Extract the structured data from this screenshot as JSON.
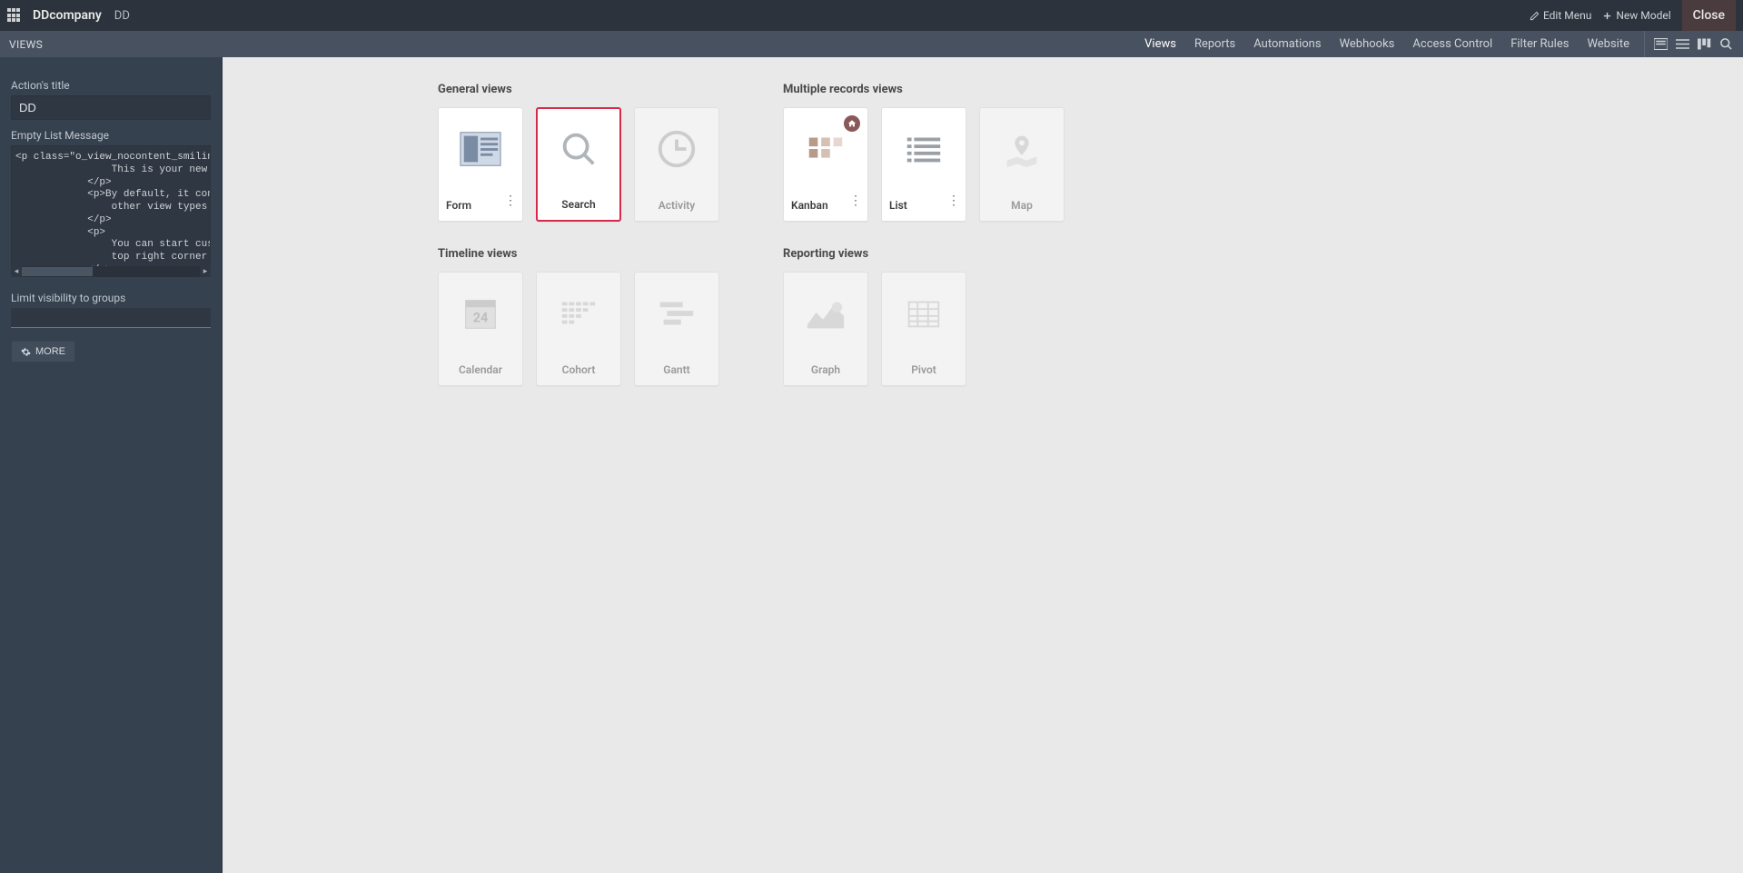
{
  "topbar": {
    "company": "DDcompany",
    "breadcrumb": "DD",
    "edit_menu": "Edit Menu",
    "new_model": "New Model",
    "close": "Close"
  },
  "subbar": {
    "title": "VIEWS",
    "tabs": [
      "Views",
      "Reports",
      "Automations",
      "Webhooks",
      "Access Control",
      "Filter Rules",
      "Website"
    ]
  },
  "sidebar": {
    "action_title_label": "Action's title",
    "action_title_value": "DD",
    "empty_list_label": "Empty List Message",
    "empty_list_value": "<p class=\"o_view_nocontent_smiling_face\">\n                This is your new action.\n            </p>\n            <p>By default, it contains a\n                other view types dependi\n            </p>\n            <p>\n                You can start customizin\n                top right corner (you ca\n            </p>",
    "limit_visibility_label": "Limit visibility to groups",
    "more_label": "MORE"
  },
  "sections": {
    "general": {
      "title": "General views",
      "cards": [
        {
          "key": "form",
          "label": "Form",
          "enabled": true,
          "kebab": true
        },
        {
          "key": "search",
          "label": "Search",
          "enabled": true,
          "selected": true
        },
        {
          "key": "activity",
          "label": "Activity",
          "enabled": false
        }
      ]
    },
    "multiple": {
      "title": "Multiple records views",
      "cards": [
        {
          "key": "kanban",
          "label": "Kanban",
          "enabled": true,
          "kebab": true,
          "home": true
        },
        {
          "key": "list",
          "label": "List",
          "enabled": true,
          "kebab": true
        },
        {
          "key": "map",
          "label": "Map",
          "enabled": false
        }
      ]
    },
    "timeline": {
      "title": "Timeline views",
      "cards": [
        {
          "key": "calendar",
          "label": "Calendar",
          "enabled": false
        },
        {
          "key": "cohort",
          "label": "Cohort",
          "enabled": false
        },
        {
          "key": "gantt",
          "label": "Gantt",
          "enabled": false
        }
      ]
    },
    "reporting": {
      "title": "Reporting views",
      "cards": [
        {
          "key": "graph",
          "label": "Graph",
          "enabled": false
        },
        {
          "key": "pivot",
          "label": "Pivot",
          "enabled": false
        }
      ]
    }
  }
}
